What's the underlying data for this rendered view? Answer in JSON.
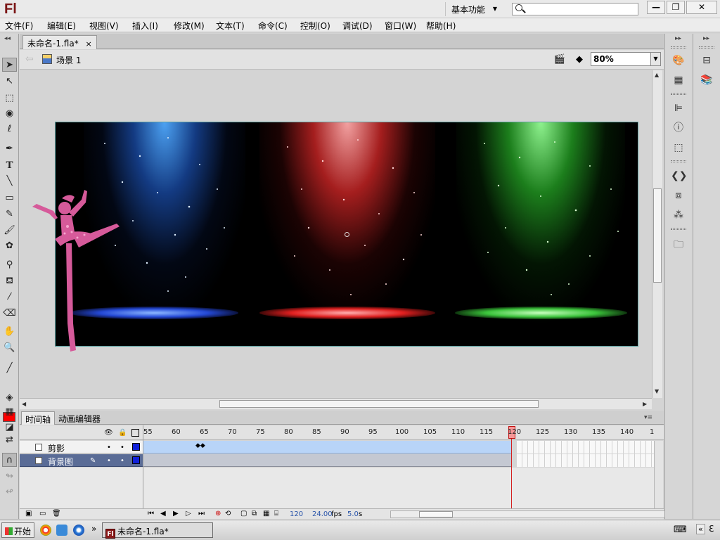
{
  "app": {
    "logo": "Fl"
  },
  "titlebar": {
    "workspace": "基本功能",
    "search_placeholder": "",
    "minimize": "—",
    "restore": "❐",
    "close": "✕"
  },
  "menu": [
    "文件(F)",
    "编辑(E)",
    "视图(V)",
    "插入(I)",
    "修改(M)",
    "文本(T)",
    "命令(C)",
    "控制(O)",
    "调试(D)",
    "窗口(W)",
    "帮助(H)"
  ],
  "document": {
    "tab_title": "未命名-1.fla*",
    "close": "×"
  },
  "editbar": {
    "scene": "场景 1",
    "zoom": "80%"
  },
  "timeline": {
    "tabs": [
      "时间轴",
      "动画编辑器"
    ],
    "ruler": [
      "55",
      "60",
      "65",
      "70",
      "75",
      "80",
      "85",
      "90",
      "95",
      "100",
      "105",
      "110",
      "115",
      "120",
      "125",
      "130",
      "135",
      "140",
      "1"
    ],
    "layers": [
      {
        "name": "剪影",
        "selected": false
      },
      {
        "name": "背景图",
        "selected": true
      }
    ],
    "footer": {
      "frame": "120",
      "fps": "24.00",
      "fps_unit": "fps",
      "time": "5.0",
      "time_unit": "s"
    }
  },
  "taskbar": {
    "start": "开始",
    "task": "未命名-1.fla*",
    "more": "»"
  },
  "colors": {
    "fill": "#ff0000",
    "layer_color": "#1020d8",
    "playhead": "#d42020"
  }
}
